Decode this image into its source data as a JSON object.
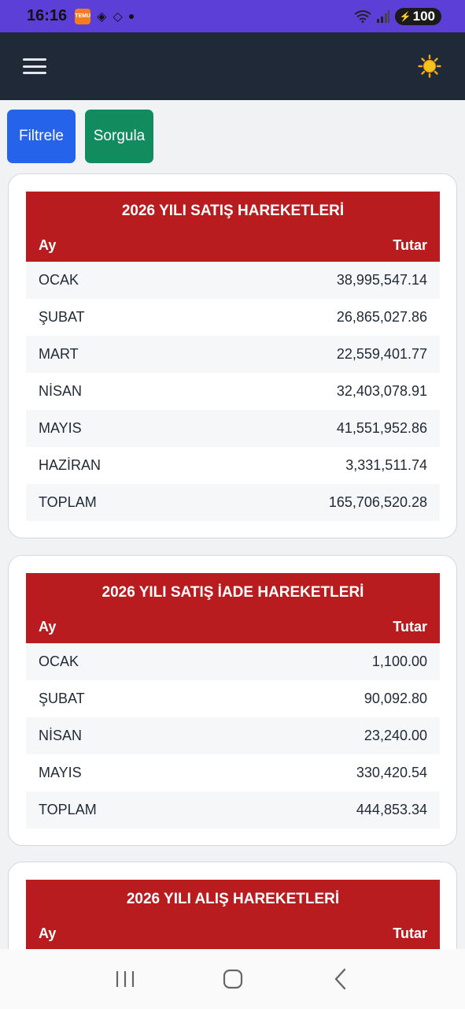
{
  "status_bar": {
    "time": "16:16",
    "app_badge": "TEMU",
    "battery": "100"
  },
  "header": {
    "menu_icon": "hamburger-icon",
    "theme_icon": "sun-icon"
  },
  "actions": {
    "filter_label": "Filtrele",
    "query_label": "Sorgula"
  },
  "tables": [
    {
      "title": "2026 YILI SATIŞ HAREKETLERİ",
      "col_month": "Ay",
      "col_amount": "Tutar",
      "rows": [
        {
          "month": "OCAK",
          "amount": "38,995,547.14"
        },
        {
          "month": "ŞUBAT",
          "amount": "26,865,027.86"
        },
        {
          "month": "MART",
          "amount": "22,559,401.77"
        },
        {
          "month": "NİSAN",
          "amount": "32,403,078.91"
        },
        {
          "month": "MAYIS",
          "amount": "41,551,952.86"
        },
        {
          "month": "HAZİRAN",
          "amount": "3,331,511.74"
        },
        {
          "month": "TOPLAM",
          "amount": "165,706,520.28"
        }
      ]
    },
    {
      "title": "2026 YILI SATIŞ İADE HAREKETLERİ",
      "col_month": "Ay",
      "col_amount": "Tutar",
      "rows": [
        {
          "month": "OCAK",
          "amount": "1,100.00"
        },
        {
          "month": "ŞUBAT",
          "amount": "90,092.80"
        },
        {
          "month": "NİSAN",
          "amount": "23,240.00"
        },
        {
          "month": "MAYIS",
          "amount": "330,420.54"
        },
        {
          "month": "TOPLAM",
          "amount": "444,853.34"
        }
      ]
    },
    {
      "title": "2026 YILI ALIŞ HAREKETLERİ",
      "col_month": "Ay",
      "col_amount": "Tutar",
      "rows": []
    }
  ],
  "colors": {
    "status_bar": "#5b3fd6",
    "header_bg": "#1f2937",
    "filter_button": "#2563eb",
    "query_button": "#128c5e",
    "table_header": "#b81c1f"
  }
}
